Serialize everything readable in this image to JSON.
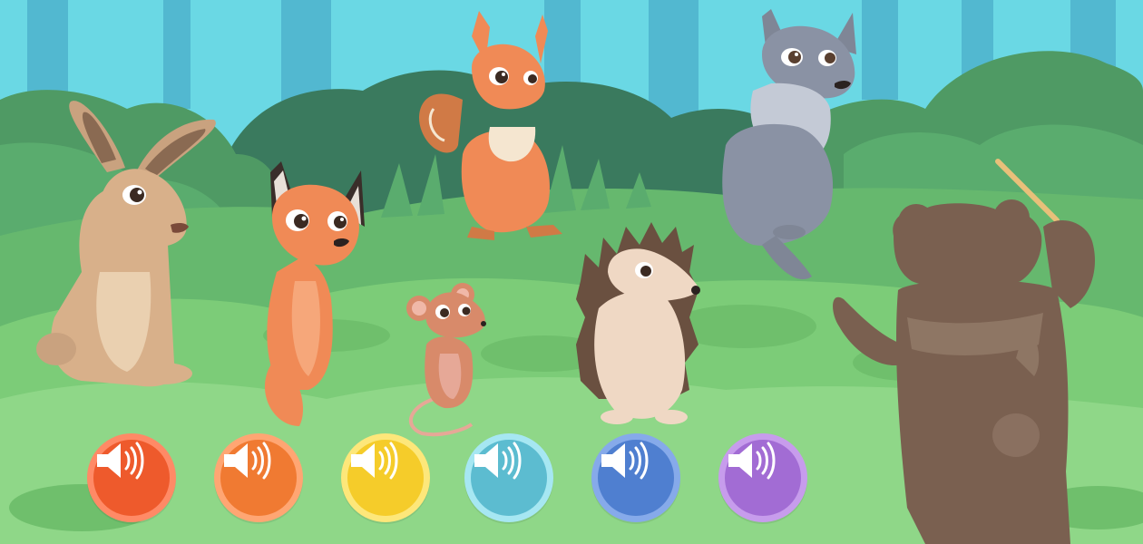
{
  "scene": {
    "name": "forest-orchestra",
    "characters": [
      "hare",
      "fox",
      "mouse",
      "squirrel",
      "hedgehog",
      "wolf",
      "bear-conductor"
    ]
  },
  "sound_buttons": [
    {
      "id": "hare",
      "icon": "speaker-icon",
      "fill": "#ee5a2c",
      "ring": "#ff8a66"
    },
    {
      "id": "fox",
      "icon": "speaker-icon",
      "fill": "#f07a32",
      "ring": "#ffa673"
    },
    {
      "id": "mouse",
      "icon": "speaker-icon",
      "fill": "#f5cc2a",
      "ring": "#fde77a"
    },
    {
      "id": "squirrel",
      "icon": "speaker-icon",
      "fill": "#5cbcd0",
      "ring": "#a6e7f2"
    },
    {
      "id": "hedgehog",
      "icon": "speaker-icon",
      "fill": "#4f7fd0",
      "ring": "#86aaea"
    },
    {
      "id": "wolf",
      "icon": "speaker-icon",
      "fill": "#a26cd4",
      "ring": "#c79cec"
    }
  ],
  "colors": {
    "sky": "#6ad8e4",
    "tree_trunk": "#52b8d0",
    "bush_dark": "#3a7a5e",
    "bush_mid": "#55a66a",
    "grass": "#7ccc78",
    "grass_light": "#8fd788"
  }
}
